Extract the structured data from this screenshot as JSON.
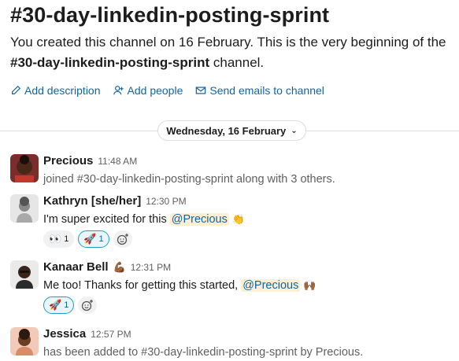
{
  "channel": {
    "title": "#30-day-linkedin-posting-sprint",
    "intro_part1": "You created this channel on 16 February. This is the very beginning of the",
    "intro_channel": "#30-day-linkedin-posting-sprint",
    "intro_part2": "channel."
  },
  "actions": {
    "add_description": "Add description",
    "add_people": "Add people",
    "send_emails": "Send emails to channel"
  },
  "date_divider": "Wednesday, 16 February",
  "messages": [
    {
      "author": "Precious",
      "time": "11:48 AM",
      "text": "joined #30-day-linkedin-posting-sprint along with 3 others."
    },
    {
      "author": "Kathryn [she/her]",
      "time": "12:30 PM",
      "text_before": "I'm super excited for this",
      "mention": "@Precious",
      "emoji": "👏",
      "reactions": [
        {
          "emoji": "👀",
          "count": "1"
        },
        {
          "emoji": "🚀",
          "count": "1"
        }
      ]
    },
    {
      "author": "Kanaar Bell",
      "author_emoji": "💪🏾",
      "time": "12:31 PM",
      "text_before": "Me too! Thanks for getting this started,",
      "mention": "@Precious",
      "emoji": "🙌🏾",
      "reactions": [
        {
          "emoji": "🚀",
          "count": "1"
        }
      ]
    },
    {
      "author": "Jessica",
      "time": "12:57 PM",
      "text": "has been added to #30-day-linkedin-posting-sprint by Precious."
    }
  ],
  "colors": {
    "link": "#1264a3",
    "mention_bg": "#fcefd3",
    "reaction_active": "#1d9bd1"
  }
}
